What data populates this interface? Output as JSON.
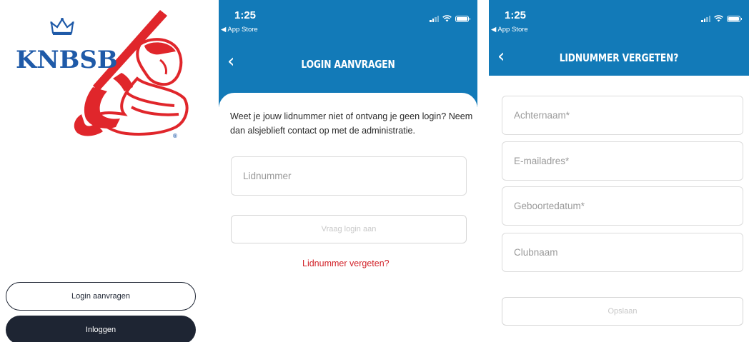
{
  "landing": {
    "logo_text": "KNBSB",
    "logo_reg": "®",
    "request_login_button": "Login aanvragen",
    "login_button": "Inloggen"
  },
  "request_screen": {
    "status": {
      "time": "1:25",
      "back": "◀ App Store"
    },
    "nav_back_glyph": "‹",
    "title": "LOGIN AANVRAGEN",
    "intro": "Weet je jouw lidnummer niet of ontvang je geen login? Neem dan alsjeblieft contact op met de administratie.",
    "member_field": {
      "placeholder": "Lidnummer"
    },
    "submit_button": "Vraag login aan",
    "forgot_link": "Lidnummer vergeten?"
  },
  "forgot_screen": {
    "status": {
      "time": "1:25",
      "back": "◀ App Store"
    },
    "nav_back_glyph": "‹",
    "title": "LIDNUMMER VERGETEN?",
    "fields": {
      "lastname": "Achternaam*",
      "email": "E-mailadres*",
      "birthdate": "Geboortedatum*",
      "club": "Clubnaam"
    },
    "save_button": "Opslaan"
  },
  "colors": {
    "brand_blue": "#127ab8",
    "logo_blue": "#1f5aa8",
    "logo_red": "#e0262b",
    "dark_button": "#1e2533",
    "link_red": "#d2232a"
  }
}
